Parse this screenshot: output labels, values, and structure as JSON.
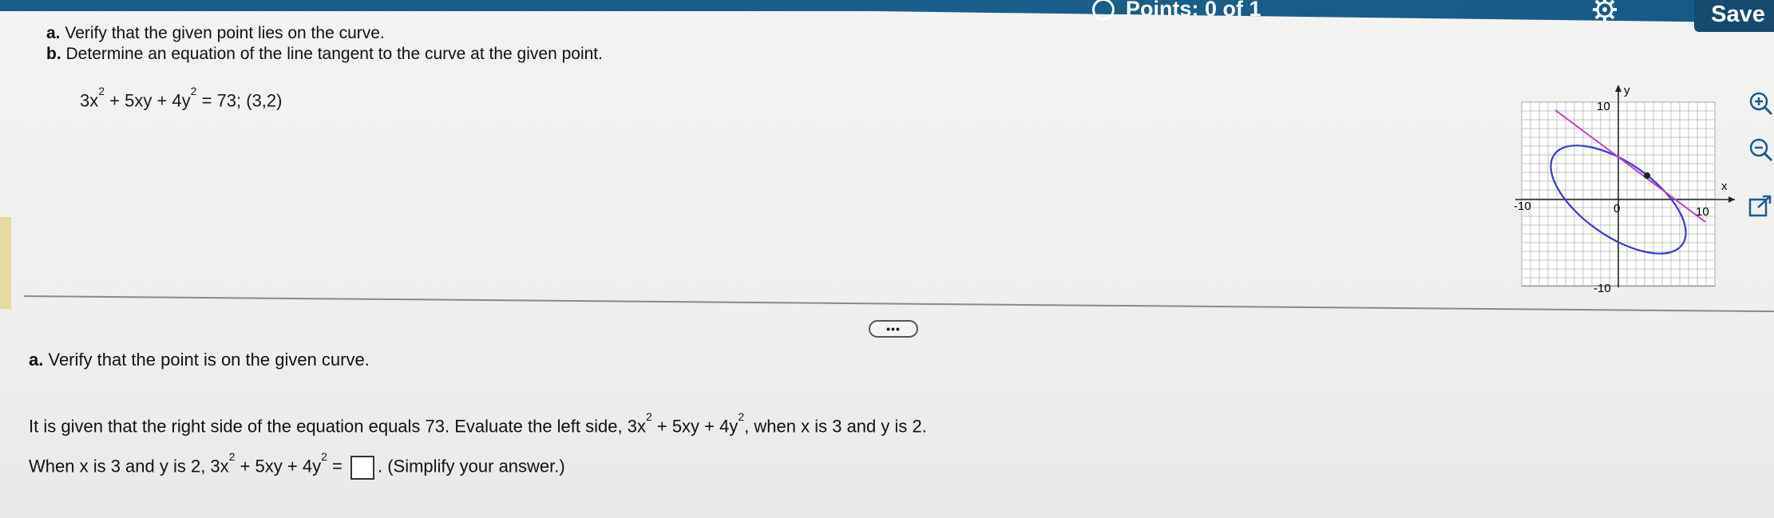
{
  "header": {
    "points_label": "Points: 0 of 1",
    "save_label": "Save",
    "gear_icon": "gear-icon"
  },
  "question": {
    "part_a_label": "a.",
    "part_a_text": "Verify that the given point lies on the curve.",
    "part_b_label": "b.",
    "part_b_text": "Determine an equation of the line tangent to the curve at the given point.",
    "equation_pre": "3x",
    "equation_mid1": " + 5xy + 4y",
    "equation_post": " = 73; (3,2)",
    "exp": "2"
  },
  "graph": {
    "x_label": "x",
    "y_label": "y",
    "tick_pos": "10",
    "tick_neg": "-10",
    "origin": "0",
    "ellipse_color": "#3a3ad0",
    "tangent_color": "#c040c0"
  },
  "solution": {
    "ellipsis_label": "•••",
    "heading_label": "a.",
    "heading_text": "Verify that the point is on the given curve.",
    "line1_a": "It is given that the right side of the equation equals 73. Evaluate the left side, 3x",
    "line1_b": " + 5xy + 4y",
    "line1_c": ", when x is 3 and y is 2.",
    "line2_a": "When x is 3 and y is 2, 3x",
    "line2_b": " + 5xy + 4y",
    "line2_c": " =",
    "line2_d": ". (Simplify your answer.)",
    "answer_value": ""
  },
  "side_tools": [
    "zoom-in-icon",
    "zoom-out-icon",
    "popout-icon"
  ]
}
